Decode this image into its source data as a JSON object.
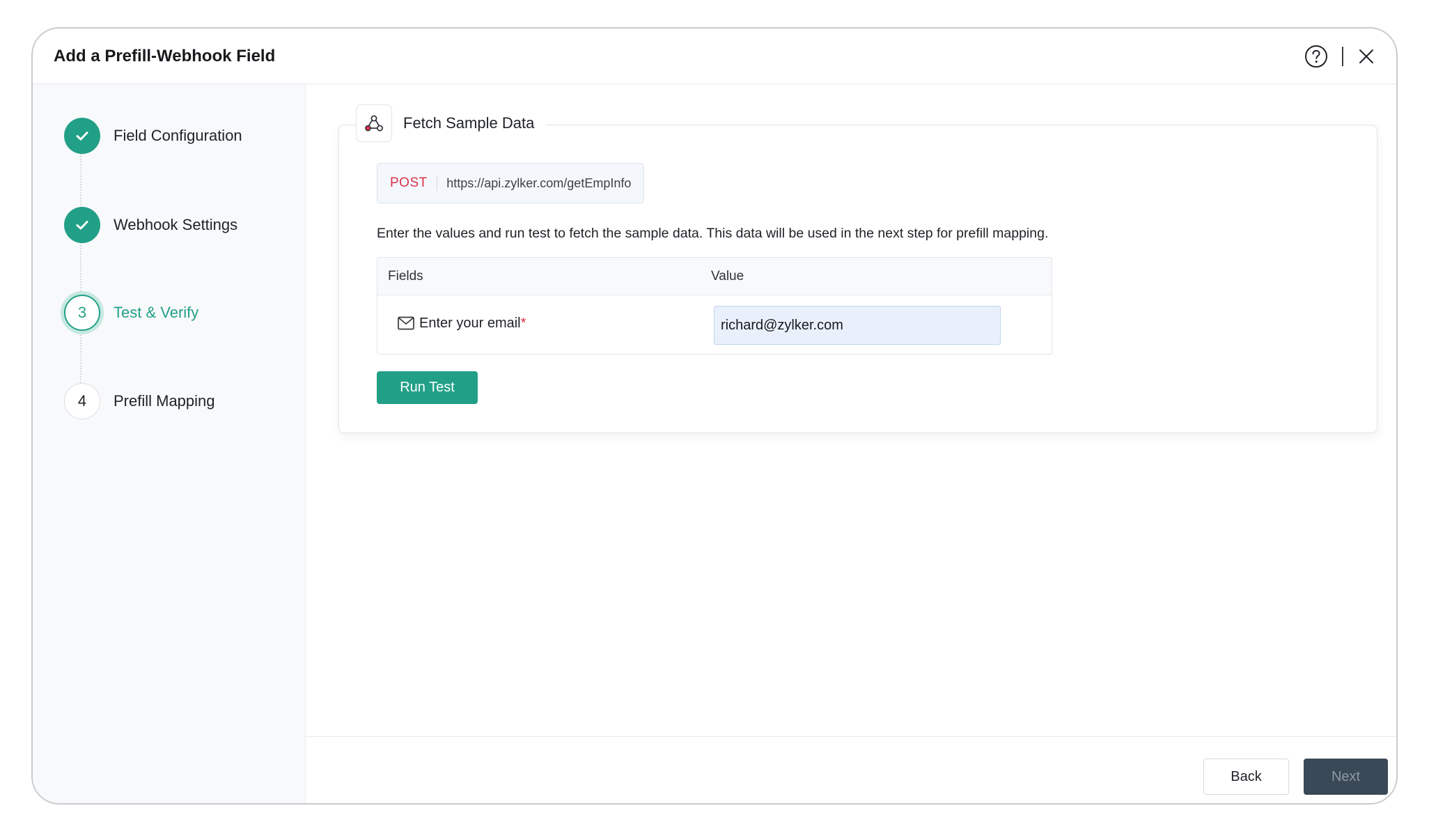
{
  "dialog": {
    "title": "Add a Prefill-Webhook Field",
    "help_icon": "question-circle-icon",
    "close_icon": "close-x-icon"
  },
  "steps": [
    {
      "number": "1",
      "label": "Field Configuration",
      "status": "completed",
      "icon": "check-icon"
    },
    {
      "number": "2",
      "label": "Webhook Settings",
      "status": "completed",
      "icon": "check-icon"
    },
    {
      "number": "3",
      "label": "Test & Verify",
      "status": "active"
    },
    {
      "number": "4",
      "label": "Prefill Mapping",
      "status": "pending"
    }
  ],
  "fetch": {
    "title": "Fetch Sample Data",
    "icon": "webhook-icon",
    "method": "POST",
    "url": "https://api.zylker.com/getEmpInfo",
    "instruction": "Enter the values and run test to fetch the sample data. This data will be used in the next step for prefill mapping.",
    "table": {
      "headers": {
        "fields": "Fields",
        "value": "Value"
      },
      "rows": [
        {
          "icon": "envelope-icon",
          "label": "Enter your email",
          "required_mark": "*",
          "value": "richard@zylker.com"
        }
      ]
    },
    "run_test_label": "Run Test"
  },
  "footer": {
    "back_label": "Back",
    "next_label": "Next"
  },
  "colors": {
    "accent": "#22a087",
    "method": "#d8334a",
    "next_button": "#3a4957"
  }
}
